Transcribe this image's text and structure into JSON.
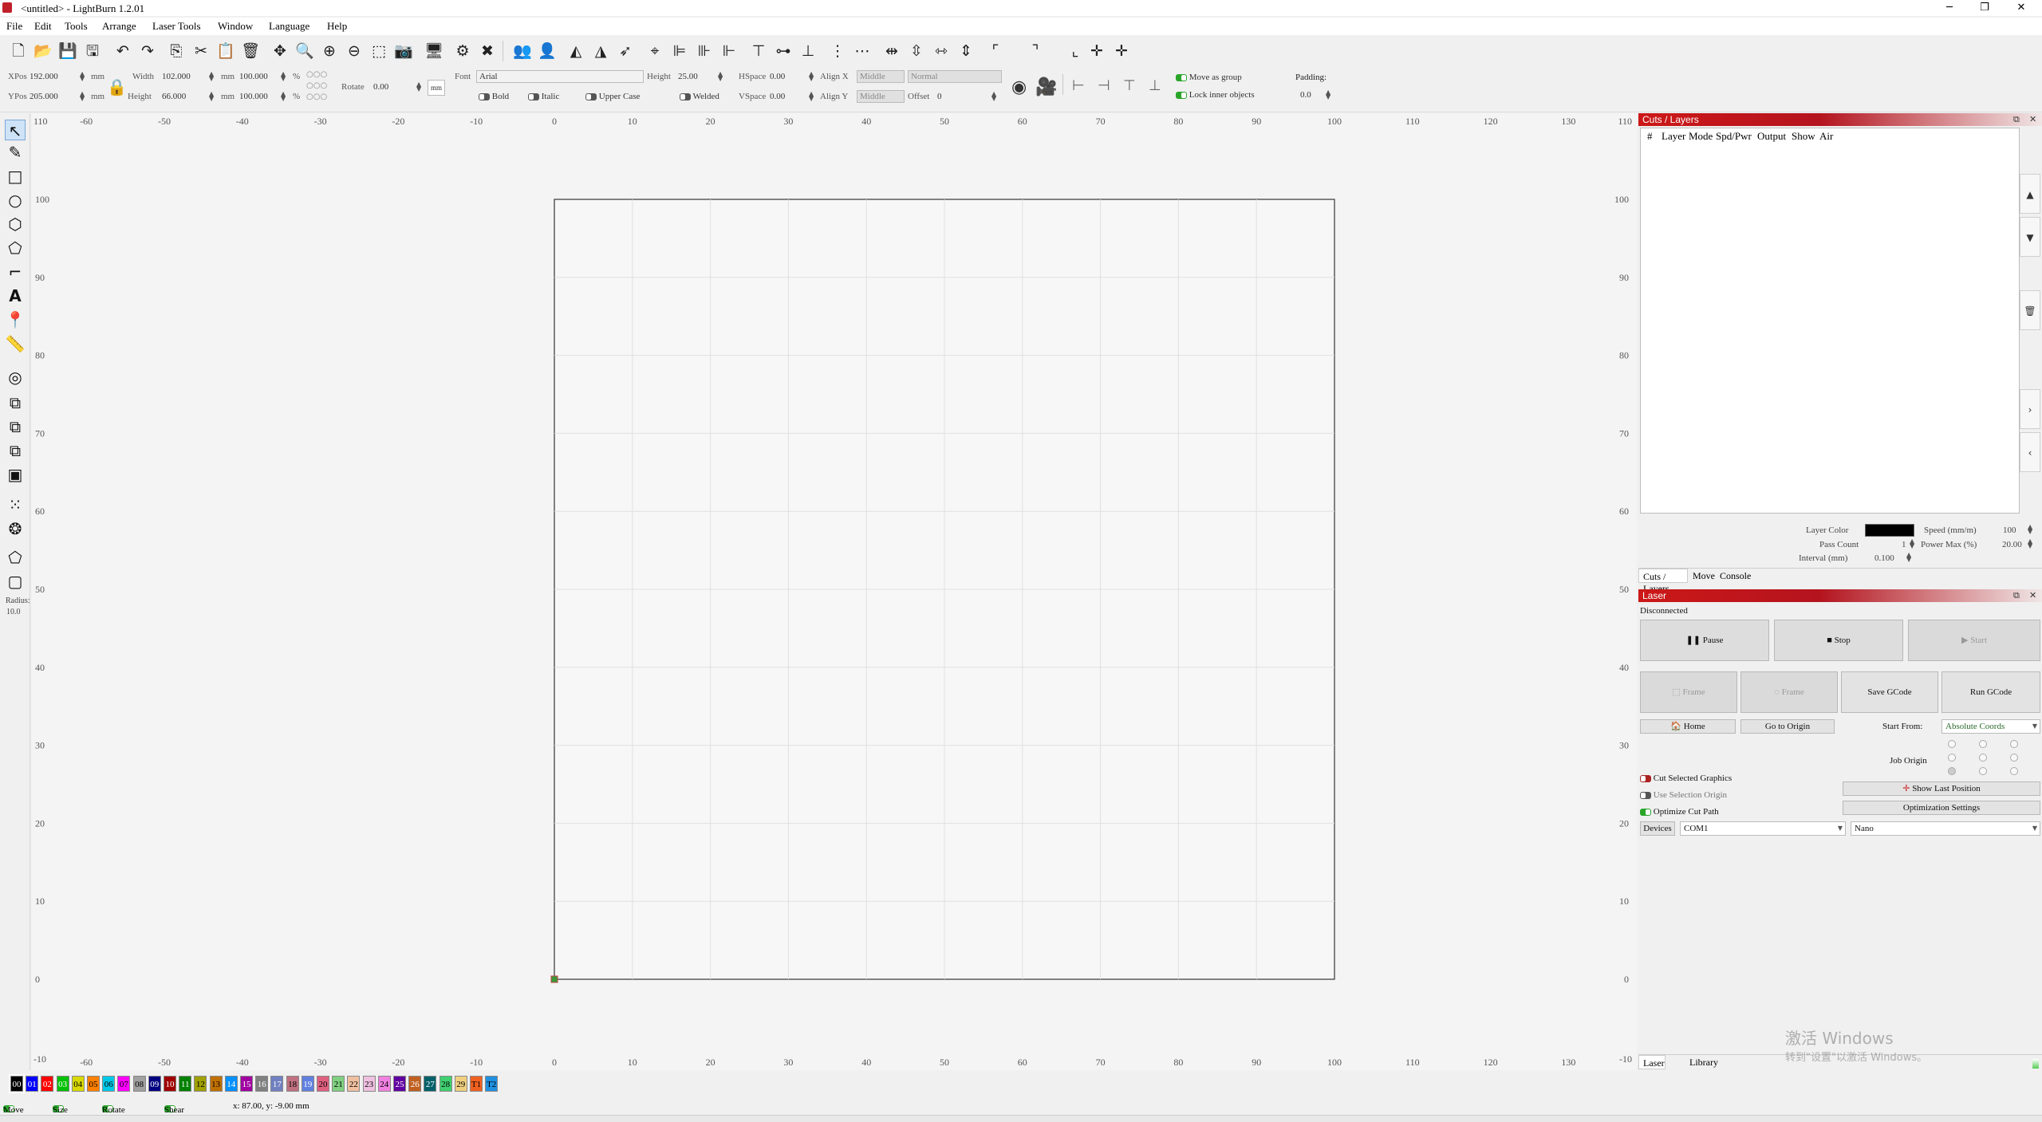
{
  "window": {
    "title": "<untitled> - LightBurn 1.2.01",
    "minimize": "─",
    "maximize": "❐",
    "close": "✕"
  },
  "menu": [
    "File",
    "Edit",
    "Tools",
    "Arrange",
    "Laser Tools",
    "Window",
    "Language",
    "Help"
  ],
  "propbar": {
    "xpos_label": "XPos",
    "xpos": "192.000",
    "ypos_label": "YPos",
    "ypos": "205.000",
    "unit": "mm",
    "width_label": "Width",
    "width": "102.000",
    "height_label": "Height",
    "height": "66.000",
    "scale_w": "100.000",
    "scale_h": "100.000",
    "pct": "%",
    "rotate_label": "Rotate",
    "rotate": "0.00",
    "font_label": "Font",
    "font": "Arial",
    "text_height_label": "Height",
    "text_height": "25.00",
    "hspace_label": "HSpace",
    "hspace": "0.00",
    "vspace_label": "VSpace",
    "vspace": "0.00",
    "alignx_label": "Align X",
    "alignx": "Middle",
    "aligny_label": "Align Y",
    "aligny": "Middle",
    "normal": "Normal",
    "offset_label": "Offset",
    "offset": "0",
    "bold": "Bold",
    "italic": "Italic",
    "upper_case": "Upper Case",
    "welded": "Welded",
    "move_as_group": "Move as group",
    "lock_inner": "Lock inner objects",
    "padding_label": "Padding:",
    "padding": "0.0"
  },
  "left_tools": {
    "radius_label": "Radius:",
    "radius": "10.0"
  },
  "ruler": {
    "x_labels": [
      "-60",
      "-50",
      "-40",
      "-30",
      "-20",
      "-10",
      "0",
      "10",
      "20",
      "30",
      "40",
      "50",
      "60",
      "70",
      "80",
      "90",
      "100",
      "110",
      "120",
      "130"
    ],
    "y_labels": [
      "100",
      "90",
      "80",
      "70",
      "60",
      "50",
      "40",
      "30",
      "20",
      "10",
      "0"
    ],
    "corner_top": "110",
    "corner_bottom": "-10"
  },
  "cuts_layers": {
    "title": "Cuts / Layers",
    "columns": [
      "#",
      "Layer",
      "Mode",
      "Spd/Pwr",
      "Output",
      "Show",
      "Air"
    ],
    "layer_color_label": "Layer Color",
    "speed_label": "Speed (mm/m)",
    "speed": "100",
    "pass_count_label": "Pass Count",
    "pass_count": "1",
    "power_max_label": "Power Max (%)",
    "power_max": "20.00",
    "interval_label": "Interval (mm)",
    "interval": "0.100",
    "tabs": [
      "Cuts / Layers",
      "Move",
      "Console"
    ],
    "colors": {
      "layer": "#000000"
    }
  },
  "laser": {
    "title": "Laser",
    "status": "Disconnected",
    "pause": "Pause",
    "stop": "Stop",
    "start": "Start",
    "frame1": "Frame",
    "frame2": "Frame",
    "save_gcode": "Save GCode",
    "run_gcode": "Run GCode",
    "home": "Home",
    "go_to_origin": "Go to Origin",
    "start_from_label": "Start From:",
    "start_from": "Absolute Coords",
    "job_origin_label": "Job Origin",
    "cut_selected": "Cut Selected Graphics",
    "use_selection_origin": "Use Selection Origin",
    "optimize_cut_path": "Optimize Cut Path",
    "show_last_position": "Show Last Position",
    "optimization_settings": "Optimization Settings",
    "devices": "Devices",
    "port": "COM1",
    "device": "Nano",
    "tabs": [
      "Laser",
      "Library"
    ]
  },
  "palette": [
    {
      "label": "00",
      "color": "#000000",
      "text": "#ffffff"
    },
    {
      "label": "01",
      "color": "#0000ff",
      "text": "#ffffff"
    },
    {
      "label": "02",
      "color": "#ff0000",
      "text": "#ffffff"
    },
    {
      "label": "03",
      "color": "#00c000",
      "text": "#ffffff"
    },
    {
      "label": "04",
      "color": "#d8d800",
      "text": "#000000"
    },
    {
      "label": "05",
      "color": "#ff8000",
      "text": "#000000"
    },
    {
      "label": "06",
      "color": "#00c8e8",
      "text": "#000000"
    },
    {
      "label": "07",
      "color": "#ff00ff",
      "text": "#000000"
    },
    {
      "label": "08",
      "color": "#a0a0a0",
      "text": "#000000"
    },
    {
      "label": "09",
      "color": "#000080",
      "text": "#ffffff"
    },
    {
      "label": "10",
      "color": "#a00000",
      "text": "#ffffff"
    },
    {
      "label": "11",
      "color": "#008000",
      "text": "#ffffff"
    },
    {
      "label": "12",
      "color": "#a0a000",
      "text": "#000000"
    },
    {
      "label": "13",
      "color": "#c07000",
      "text": "#000000"
    },
    {
      "label": "14",
      "color": "#0090ff",
      "text": "#ffffff"
    },
    {
      "label": "15",
      "color": "#a000a0",
      "text": "#ffffff"
    },
    {
      "label": "16",
      "color": "#808080",
      "text": "#ffffff"
    },
    {
      "label": "17",
      "color": "#7080c0",
      "text": "#ffffff"
    },
    {
      "label": "18",
      "color": "#c07080",
      "text": "#000000"
    },
    {
      "label": "19",
      "color": "#6080e0",
      "text": "#ffffff"
    },
    {
      "label": "20",
      "color": "#e06080",
      "text": "#000000"
    },
    {
      "label": "21",
      "color": "#80d080",
      "text": "#000000"
    },
    {
      "label": "22",
      "color": "#f0c0a0",
      "text": "#000000"
    },
    {
      "label": "23",
      "color": "#f0c0e0",
      "text": "#000000"
    },
    {
      "label": "24",
      "color": "#f080e0",
      "text": "#000000"
    },
    {
      "label": "25",
      "color": "#6000a0",
      "text": "#ffffff"
    },
    {
      "label": "26",
      "color": "#c06020",
      "text": "#ffffff"
    },
    {
      "label": "27",
      "color": "#00606a",
      "text": "#ffffff"
    },
    {
      "label": "28",
      "color": "#40d070",
      "text": "#000000"
    },
    {
      "label": "29",
      "color": "#f0d080",
      "text": "#000000"
    },
    {
      "label": "T1",
      "color": "#f06020",
      "text": "#000000"
    },
    {
      "label": "T2",
      "color": "#2090e0",
      "text": "#000000"
    }
  ],
  "status": {
    "move": "Move",
    "size": "Size",
    "rotate": "Rotate",
    "shear": "Shear",
    "coords": "x: 87.00, y: -9.00 mm"
  },
  "watermark": {
    "line1": "激活 Windows",
    "line2": "转到\"设置\"以激活 Windows。"
  }
}
